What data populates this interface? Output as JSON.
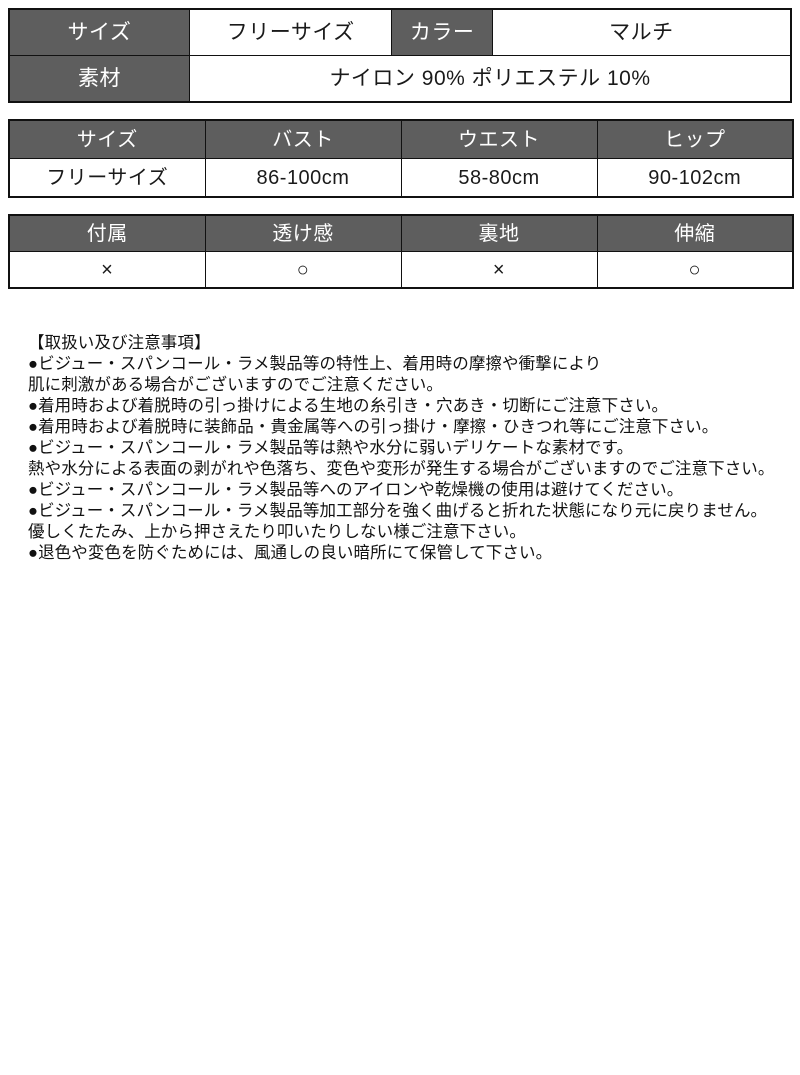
{
  "basic_table": {
    "rows": [
      {
        "cells": [
          {
            "text": "サイズ",
            "type": "header"
          },
          {
            "text": "フリーサイズ",
            "type": "value"
          },
          {
            "text": "カラー",
            "type": "header"
          },
          {
            "text": "マルチ",
            "type": "value"
          }
        ]
      },
      {
        "cells": [
          {
            "text": "素材",
            "type": "header"
          },
          {
            "text": "ナイロン 90%  ポリエステル 10%",
            "type": "value"
          }
        ]
      }
    ]
  },
  "measure_table": {
    "headers": [
      "サイズ",
      "バスト",
      "ウエスト",
      "ヒップ"
    ],
    "values": [
      "フリーサイズ",
      "86-100cm",
      "58-80cm",
      "90-102cm"
    ]
  },
  "features_table": {
    "headers": [
      "付属",
      "透け感",
      "裏地",
      "伸縮"
    ],
    "values": [
      "×",
      "○",
      "×",
      "○"
    ]
  },
  "notes": {
    "title": "【取扱い及び注意事項】",
    "lines": [
      "●ビジュー・スパンコール・ラメ製品等の特性上、着用時の摩擦や衝撃により",
      "肌に刺激がある場合がございますのでご注意ください。",
      "●着用時および着脱時の引っ掛けによる生地の糸引き・穴あき・切断にご注意下さい。",
      "●着用時および着脱時に装飾品・貴金属等への引っ掛け・摩擦・ひきつれ等にご注意下さい。",
      "●ビジュー・スパンコール・ラメ製品等は熱や水分に弱いデリケートな素材です。",
      "熱や水分による表面の剥がれや色落ち、変色や変形が発生する場合がございますのでご注意下さい。",
      "●ビジュー・スパンコール・ラメ製品等へのアイロンや乾燥機の使用は避けてください。",
      "●ビジュー・スパンコール・ラメ製品等加工部分を強く曲げると折れた状態になり元に戻りません。",
      "優しくたたみ、上から押さえたり叩いたりしない様ご注意下さい。",
      "●退色や変色を防ぐためには、風通しの良い暗所にて保管して下さい。"
    ]
  },
  "colors": {
    "header_bg": "#5e5e5e",
    "header_text": "#ffffff",
    "cell_bg": "#ffffff",
    "border": "#111111",
    "body_text": "#111111"
  }
}
